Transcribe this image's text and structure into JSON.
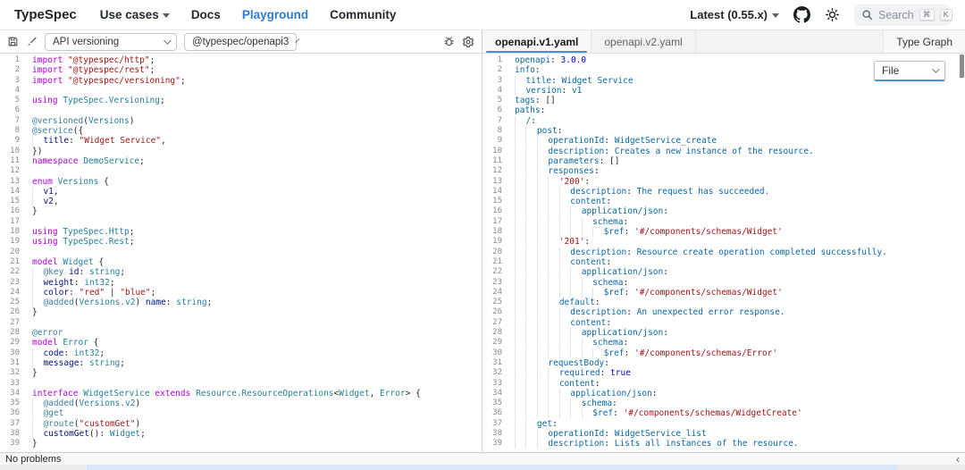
{
  "header": {
    "logo": "TypeSpec",
    "nav": [
      {
        "label": "Use cases",
        "caret": true,
        "active": false
      },
      {
        "label": "Docs",
        "caret": false,
        "active": false
      },
      {
        "label": "Playground",
        "caret": false,
        "active": true
      },
      {
        "label": "Community",
        "caret": false,
        "active": false
      }
    ],
    "version_label": "Latest (0.55.x)",
    "search": {
      "placeholder": "Search",
      "kbd1": "⌘",
      "kbd2": "K"
    }
  },
  "toolbar": {
    "sample_select_value": "API versioning",
    "emitter_select_value": "@typespec/openapi3",
    "tabs": [
      {
        "label": "openapi.v1.yaml",
        "active": true
      },
      {
        "label": "openapi.v2.yaml",
        "active": false
      }
    ],
    "type_graph_label": "Type Graph"
  },
  "output": {
    "file_dropdown_label": "File"
  },
  "status_bar": {
    "message": "No problems"
  },
  "colors": {
    "accent_blue": "#2b7cd3",
    "keyword": "#af00db",
    "string": "#a31515",
    "type": "#267f99",
    "yaml_key": "#0a67a3"
  },
  "editors": {
    "left": {
      "lines": [
        [
          [
            "k",
            "import "
          ],
          [
            "s",
            "\"@typespec/http\""
          ],
          [
            "p",
            ";"
          ]
        ],
        [
          [
            "k",
            "import "
          ],
          [
            "s",
            "\"@typespec/rest\""
          ],
          [
            "p",
            ";"
          ]
        ],
        [
          [
            "k",
            "import "
          ],
          [
            "s",
            "\"@typespec/versioning\""
          ],
          [
            "p",
            ";"
          ]
        ],
        [],
        [
          [
            "k",
            "using "
          ],
          [
            "t",
            "TypeSpec.Versioning"
          ],
          [
            "p",
            ";"
          ]
        ],
        [],
        [
          [
            "d",
            "@versioned"
          ],
          [
            "p",
            "("
          ],
          [
            "t",
            "Versions"
          ],
          [
            "p",
            ")"
          ]
        ],
        [
          [
            "d",
            "@service"
          ],
          [
            "p",
            "({"
          ]
        ],
        [
          [
            "p",
            "  "
          ],
          [
            "v",
            "title"
          ],
          [
            "p",
            ": "
          ],
          [
            "s",
            "\"Widget Service\""
          ],
          [
            "p",
            ","
          ]
        ],
        [
          [
            "p",
            "})"
          ]
        ],
        [
          [
            "k",
            "namespace "
          ],
          [
            "t",
            "DemoService"
          ],
          [
            "p",
            ";"
          ]
        ],
        [],
        [
          [
            "k",
            "enum "
          ],
          [
            "t",
            "Versions"
          ],
          [
            "p",
            " {"
          ]
        ],
        [
          [
            "p",
            "  "
          ],
          [
            "v",
            "v1"
          ],
          [
            "p",
            ","
          ]
        ],
        [
          [
            "p",
            "  "
          ],
          [
            "v",
            "v2"
          ],
          [
            "p",
            ","
          ]
        ],
        [
          [
            "p",
            "}"
          ]
        ],
        [],
        [
          [
            "k",
            "using "
          ],
          [
            "t",
            "TypeSpec.Http"
          ],
          [
            "p",
            ";"
          ]
        ],
        [
          [
            "k",
            "using "
          ],
          [
            "t",
            "TypeSpec.Rest"
          ],
          [
            "p",
            ";"
          ]
        ],
        [],
        [
          [
            "k",
            "model "
          ],
          [
            "t",
            "Widget"
          ],
          [
            "p",
            " {"
          ]
        ],
        [
          [
            "p",
            "  "
          ],
          [
            "d",
            "@key"
          ],
          [
            "p",
            " "
          ],
          [
            "v",
            "id"
          ],
          [
            "p",
            ": "
          ],
          [
            "t",
            "string"
          ],
          [
            "p",
            ";"
          ]
        ],
        [
          [
            "p",
            "  "
          ],
          [
            "v",
            "weight"
          ],
          [
            "p",
            ": "
          ],
          [
            "t",
            "int32"
          ],
          [
            "p",
            ";"
          ]
        ],
        [
          [
            "p",
            "  "
          ],
          [
            "v",
            "color"
          ],
          [
            "p",
            ": "
          ],
          [
            "s",
            "\"red\""
          ],
          [
            "p",
            " | "
          ],
          [
            "s",
            "\"blue\""
          ],
          [
            "p",
            ";"
          ]
        ],
        [
          [
            "p",
            "  "
          ],
          [
            "d",
            "@added"
          ],
          [
            "p",
            "("
          ],
          [
            "t",
            "Versions.v2"
          ],
          [
            "p",
            ") "
          ],
          [
            "v",
            "name"
          ],
          [
            "p",
            ": "
          ],
          [
            "t",
            "string"
          ],
          [
            "p",
            ";"
          ]
        ],
        [
          [
            "p",
            "}"
          ]
        ],
        [],
        [
          [
            "d",
            "@error"
          ]
        ],
        [
          [
            "k",
            "model "
          ],
          [
            "t",
            "Error"
          ],
          [
            "p",
            " {"
          ]
        ],
        [
          [
            "p",
            "  "
          ],
          [
            "v",
            "code"
          ],
          [
            "p",
            ": "
          ],
          [
            "t",
            "int32"
          ],
          [
            "p",
            ";"
          ]
        ],
        [
          [
            "p",
            "  "
          ],
          [
            "v",
            "message"
          ],
          [
            "p",
            ": "
          ],
          [
            "t",
            "string"
          ],
          [
            "p",
            ";"
          ]
        ],
        [
          [
            "p",
            "}"
          ]
        ],
        [],
        [
          [
            "k",
            "interface "
          ],
          [
            "t",
            "WidgetService"
          ],
          [
            "p",
            " "
          ],
          [
            "k",
            "extends"
          ],
          [
            "p",
            " "
          ],
          [
            "t",
            "Resource.ResourceOperations"
          ],
          [
            "p",
            "<"
          ],
          [
            "t",
            "Widget"
          ],
          [
            "p",
            ", "
          ],
          [
            "t",
            "Error"
          ],
          [
            "p",
            "> {"
          ]
        ],
        [
          [
            "p",
            "  "
          ],
          [
            "d",
            "@added"
          ],
          [
            "p",
            "("
          ],
          [
            "t",
            "Versions.v2"
          ],
          [
            "p",
            ")"
          ]
        ],
        [
          [
            "p",
            "  "
          ],
          [
            "d",
            "@get"
          ]
        ],
        [
          [
            "p",
            "  "
          ],
          [
            "d",
            "@route"
          ],
          [
            "p",
            "("
          ],
          [
            "s",
            "\"customGet\""
          ],
          [
            "p",
            ")"
          ]
        ],
        [
          [
            "p",
            "  "
          ],
          [
            "v",
            "customGet"
          ],
          [
            "p",
            "(): "
          ],
          [
            "t",
            "Widget"
          ],
          [
            "p",
            ";"
          ]
        ],
        [
          [
            "p",
            "}"
          ]
        ]
      ]
    },
    "right": {
      "lines": [
        [
          [
            "y",
            "openapi"
          ],
          [
            "p",
            ": "
          ],
          [
            "n",
            "3.0.0"
          ]
        ],
        [
          [
            "y",
            "info"
          ],
          [
            "p",
            ":"
          ]
        ],
        [
          [
            "p",
            "  "
          ],
          [
            "y",
            "title"
          ],
          [
            "p",
            ": "
          ],
          [
            "u",
            "Widget Service"
          ]
        ],
        [
          [
            "p",
            "  "
          ],
          [
            "y",
            "version"
          ],
          [
            "p",
            ": "
          ],
          [
            "u",
            "v1"
          ]
        ],
        [
          [
            "y",
            "tags"
          ],
          [
            "p",
            ": []"
          ]
        ],
        [
          [
            "y",
            "paths"
          ],
          [
            "p",
            ":"
          ]
        ],
        [
          [
            "p",
            "  "
          ],
          [
            "y",
            "/"
          ],
          [
            "p",
            ":"
          ]
        ],
        [
          [
            "p",
            "    "
          ],
          [
            "y",
            "post"
          ],
          [
            "p",
            ":"
          ]
        ],
        [
          [
            "p",
            "      "
          ],
          [
            "y",
            "operationId"
          ],
          [
            "p",
            ": "
          ],
          [
            "u",
            "WidgetService_create"
          ]
        ],
        [
          [
            "p",
            "      "
          ],
          [
            "y",
            "description"
          ],
          [
            "p",
            ": "
          ],
          [
            "u",
            "Creates a new instance of the resource."
          ]
        ],
        [
          [
            "p",
            "      "
          ],
          [
            "y",
            "parameters"
          ],
          [
            "p",
            ": []"
          ]
        ],
        [
          [
            "p",
            "      "
          ],
          [
            "y",
            "responses"
          ],
          [
            "p",
            ":"
          ]
        ],
        [
          [
            "p",
            "        "
          ],
          [
            "s",
            "'200'"
          ],
          [
            "p",
            ":"
          ]
        ],
        [
          [
            "p",
            "          "
          ],
          [
            "y",
            "description"
          ],
          [
            "p",
            ": "
          ],
          [
            "u",
            "The request has succeeded."
          ]
        ],
        [
          [
            "p",
            "          "
          ],
          [
            "y",
            "content"
          ],
          [
            "p",
            ":"
          ]
        ],
        [
          [
            "p",
            "            "
          ],
          [
            "y",
            "application/json"
          ],
          [
            "p",
            ":"
          ]
        ],
        [
          [
            "p",
            "              "
          ],
          [
            "y",
            "schema"
          ],
          [
            "p",
            ":"
          ]
        ],
        [
          [
            "p",
            "                "
          ],
          [
            "y",
            "$ref"
          ],
          [
            "p",
            ": "
          ],
          [
            "s",
            "'#/components/schemas/Widget'"
          ]
        ],
        [
          [
            "p",
            "        "
          ],
          [
            "s",
            "'201'"
          ],
          [
            "p",
            ":"
          ]
        ],
        [
          [
            "p",
            "          "
          ],
          [
            "y",
            "description"
          ],
          [
            "p",
            ": "
          ],
          [
            "u",
            "Resource create operation completed successfully."
          ]
        ],
        [
          [
            "p",
            "          "
          ],
          [
            "y",
            "content"
          ],
          [
            "p",
            ":"
          ]
        ],
        [
          [
            "p",
            "            "
          ],
          [
            "y",
            "application/json"
          ],
          [
            "p",
            ":"
          ]
        ],
        [
          [
            "p",
            "              "
          ],
          [
            "y",
            "schema"
          ],
          [
            "p",
            ":"
          ]
        ],
        [
          [
            "p",
            "                "
          ],
          [
            "y",
            "$ref"
          ],
          [
            "p",
            ": "
          ],
          [
            "s",
            "'#/components/schemas/Widget'"
          ]
        ],
        [
          [
            "p",
            "        "
          ],
          [
            "y",
            "default"
          ],
          [
            "p",
            ":"
          ]
        ],
        [
          [
            "p",
            "          "
          ],
          [
            "y",
            "description"
          ],
          [
            "p",
            ": "
          ],
          [
            "u",
            "An unexpected error response."
          ]
        ],
        [
          [
            "p",
            "          "
          ],
          [
            "y",
            "content"
          ],
          [
            "p",
            ":"
          ]
        ],
        [
          [
            "p",
            "            "
          ],
          [
            "y",
            "application/json"
          ],
          [
            "p",
            ":"
          ]
        ],
        [
          [
            "p",
            "              "
          ],
          [
            "y",
            "schema"
          ],
          [
            "p",
            ":"
          ]
        ],
        [
          [
            "p",
            "                "
          ],
          [
            "y",
            "$ref"
          ],
          [
            "p",
            ": "
          ],
          [
            "s",
            "'#/components/schemas/Error'"
          ]
        ],
        [
          [
            "p",
            "      "
          ],
          [
            "y",
            "requestBody"
          ],
          [
            "p",
            ":"
          ]
        ],
        [
          [
            "p",
            "        "
          ],
          [
            "y",
            "required"
          ],
          [
            "p",
            ": "
          ],
          [
            "n",
            "true"
          ]
        ],
        [
          [
            "p",
            "        "
          ],
          [
            "y",
            "content"
          ],
          [
            "p",
            ":"
          ]
        ],
        [
          [
            "p",
            "          "
          ],
          [
            "y",
            "application/json"
          ],
          [
            "p",
            ":"
          ]
        ],
        [
          [
            "p",
            "            "
          ],
          [
            "y",
            "schema"
          ],
          [
            "p",
            ":"
          ]
        ],
        [
          [
            "p",
            "              "
          ],
          [
            "y",
            "$ref"
          ],
          [
            "p",
            ": "
          ],
          [
            "s",
            "'#/components/schemas/WidgetCreate'"
          ]
        ],
        [
          [
            "p",
            "    "
          ],
          [
            "y",
            "get"
          ],
          [
            "p",
            ":"
          ]
        ],
        [
          [
            "p",
            "      "
          ],
          [
            "y",
            "operationId"
          ],
          [
            "p",
            ": "
          ],
          [
            "u",
            "WidgetService_list"
          ]
        ],
        [
          [
            "p",
            "      "
          ],
          [
            "y",
            "description"
          ],
          [
            "p",
            ": "
          ],
          [
            "u",
            "Lists all instances of the resource."
          ]
        ]
      ]
    }
  }
}
